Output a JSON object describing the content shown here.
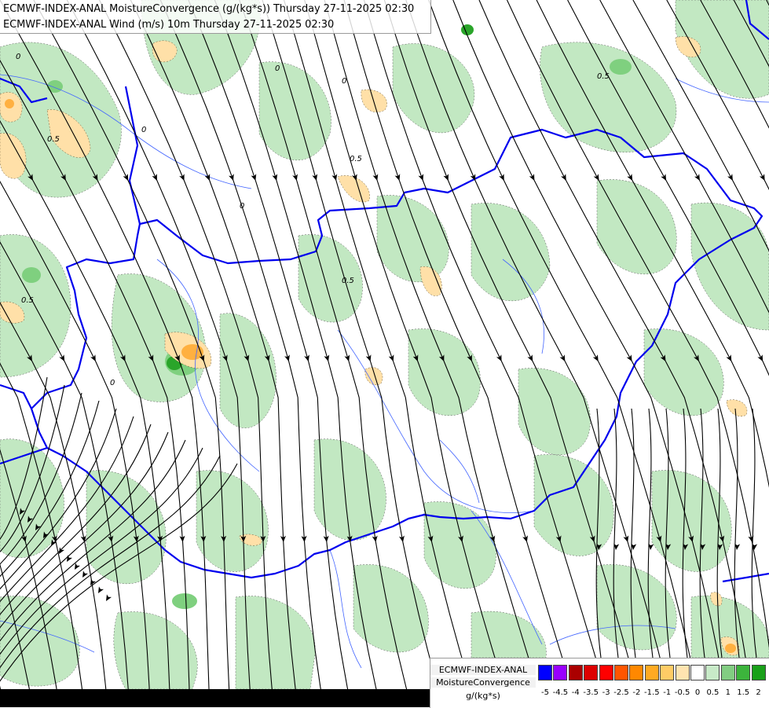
{
  "title": {
    "line1": "ECMWF-INDEX-ANAL MoistureConvergence (g/(kg*s)) Thursday 27-11-2025 02:30",
    "line2": "ECMWF-INDEX-ANAL Wind (m/s) 10m Thursday 27-11-2025 02:30"
  },
  "legend": {
    "model": "ECMWF-INDEX-ANAL",
    "parameter": "MoistureConvergence",
    "unit": "g/(kg*s)",
    "ticks": [
      "-5",
      "-4.5",
      "-4",
      "-3.5",
      "-3",
      "-2.5",
      "-2",
      "-1.5",
      "-1",
      "-0.5",
      "0",
      "0.5",
      "1",
      "1.5",
      "2"
    ],
    "colors": [
      "#0000ff",
      "#9900ff",
      "#aa0000",
      "#dd0000",
      "#ff0000",
      "#ff5500",
      "#ff8800",
      "#ffaa22",
      "#ffcc66",
      "#ffe4b0",
      "#ffffff",
      "#c8eac8",
      "#82cd82",
      "#3cb43c",
      "#19a019"
    ]
  },
  "map": {
    "contour_labels": [
      "0",
      "0",
      "0",
      "0",
      "0.5",
      "0.5",
      "0.5",
      "0.5",
      "0.5",
      "0",
      "0"
    ],
    "colors": {
      "background": "#ffffff",
      "convergence_light": "#c2e8c2",
      "convergence_medium": "#7fd07f",
      "convergence_strong": "#2aa52a",
      "divergence_light": "#ffe0a8",
      "divergence_medium": "#ffb040",
      "border": "#0000ee",
      "rivers": "#4466ff",
      "streamlines": "#000000"
    }
  }
}
